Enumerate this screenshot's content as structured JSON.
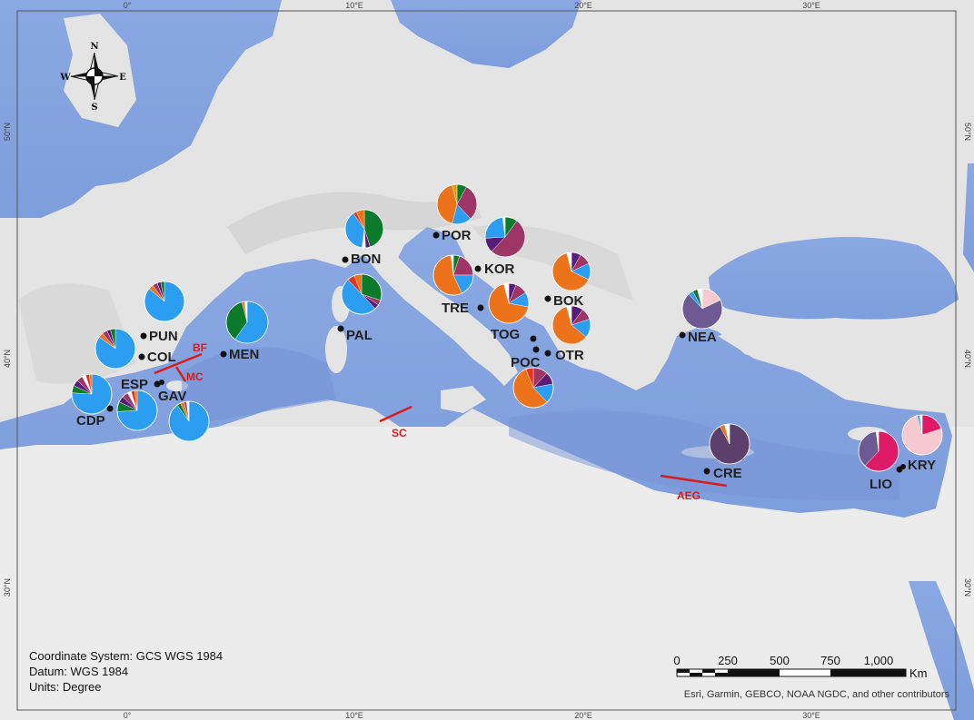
{
  "map": {
    "graticule": {
      "longitude_labels": [
        "0°",
        "10°E",
        "20°E",
        "30°E"
      ],
      "latitude_labels": [
        "50°N",
        "40°N",
        "30°N"
      ]
    },
    "compass": {
      "n": "N",
      "s": "S",
      "e": "E",
      "w": "W"
    },
    "colors": {
      "sea": "#b3c9ee",
      "deep_sea": "#8faee6",
      "land": "#e6e6e6",
      "blue": "#2c9ef2",
      "orange": "#ec7319",
      "green": "#0c7a2b",
      "maroon": "#9d3565",
      "purple": "#5a1c7a",
      "slate_purple": "#6e5a93",
      "dark_purple": "#5c3f6b",
      "magenta": "#de1966",
      "pink": "#f6c8d0",
      "red": "#e8311e",
      "gold": "#d8a21c",
      "white": "#ffffff",
      "barrier": "#d81b1b"
    },
    "sites": [
      {
        "code": "PUN",
        "pie": [
          [
            "blue",
            0.86
          ],
          [
            "orange",
            0.04
          ],
          [
            "maroon",
            0.04
          ],
          [
            "purple",
            0.03
          ],
          [
            "green",
            0.03
          ]
        ]
      },
      {
        "code": "COL",
        "pie": [
          [
            "blue",
            0.85
          ],
          [
            "orange",
            0.04
          ],
          [
            "maroon",
            0.04
          ],
          [
            "purple",
            0.03
          ],
          [
            "green",
            0.04
          ]
        ]
      },
      {
        "code": "ESP",
        "pie": [
          [
            "blue",
            0.9
          ],
          [
            "green",
            0.03
          ],
          [
            "orange",
            0.03
          ],
          [
            "maroon",
            0.02
          ],
          [
            "white",
            0.02
          ]
        ]
      },
      {
        "code": "GAV",
        "pie": [
          [
            "blue",
            0.74
          ],
          [
            "green",
            0.08
          ],
          [
            "purple",
            0.05
          ],
          [
            "maroon",
            0.05
          ],
          [
            "white",
            0.03
          ],
          [
            "red",
            0.03
          ],
          [
            "orange",
            0.02
          ]
        ]
      },
      {
        "code": "CDP",
        "pie": [
          [
            "blue",
            0.76
          ],
          [
            "green",
            0.06
          ],
          [
            "purple",
            0.05
          ],
          [
            "maroon",
            0.05
          ],
          [
            "white",
            0.03
          ],
          [
            "red",
            0.03
          ],
          [
            "orange",
            0.02
          ]
        ]
      },
      {
        "code": "MEN",
        "pie": [
          [
            "blue",
            0.6
          ],
          [
            "green",
            0.36
          ],
          [
            "orange",
            0.02
          ],
          [
            "white",
            0.02
          ]
        ]
      },
      {
        "code": "BON",
        "pie": [
          [
            "green",
            0.45
          ],
          [
            "purple",
            0.04
          ],
          [
            "white",
            0.03
          ],
          [
            "blue",
            0.38
          ],
          [
            "red",
            0.03
          ],
          [
            "orange",
            0.07
          ]
        ]
      },
      {
        "code": "PAL",
        "pie": [
          [
            "green",
            0.3
          ],
          [
            "maroon",
            0.04
          ],
          [
            "purple",
            0.04
          ],
          [
            "blue",
            0.5
          ],
          [
            "red",
            0.06
          ],
          [
            "orange",
            0.06
          ]
        ]
      },
      {
        "code": "POR",
        "pie": [
          [
            "green",
            0.08
          ],
          [
            "maroon",
            0.3
          ],
          [
            "blue",
            0.16
          ],
          [
            "orange",
            0.42
          ],
          [
            "gold",
            0.04
          ]
        ]
      },
      {
        "code": "KOR",
        "pie": [
          [
            "green",
            0.1
          ],
          [
            "maroon",
            0.52
          ],
          [
            "purple",
            0.12
          ],
          [
            "blue",
            0.24
          ],
          [
            "white",
            0.02
          ]
        ]
      },
      {
        "code": "TRE",
        "pie": [
          [
            "green",
            0.05
          ],
          [
            "maroon",
            0.2
          ],
          [
            "blue",
            0.18
          ],
          [
            "orange",
            0.55
          ],
          [
            "white",
            0.02
          ]
        ]
      },
      {
        "code": "TOG",
        "pie": [
          [
            "purple",
            0.06
          ],
          [
            "maroon",
            0.1
          ],
          [
            "blue",
            0.12
          ],
          [
            "orange",
            0.68
          ],
          [
            "white",
            0.04
          ]
        ]
      },
      {
        "code": "BOK",
        "pie": [
          [
            "purple",
            0.08
          ],
          [
            "maroon",
            0.1
          ],
          [
            "blue",
            0.14
          ],
          [
            "orange",
            0.64
          ],
          [
            "white",
            0.04
          ]
        ]
      },
      {
        "code": "OTR",
        "pie": [
          [
            "purple",
            0.1
          ],
          [
            "maroon",
            0.1
          ],
          [
            "blue",
            0.16
          ],
          [
            "orange",
            0.6
          ],
          [
            "white",
            0.04
          ]
        ]
      },
      {
        "code": "POC",
        "pie": [
          [
            "maroon",
            0.12
          ],
          [
            "purple",
            0.1
          ],
          [
            "blue",
            0.16
          ],
          [
            "orange",
            0.56
          ],
          [
            "red",
            0.06
          ]
        ]
      },
      {
        "code": "NEA",
        "pie": [
          [
            "pink",
            0.18
          ],
          [
            "slate_purple",
            0.7
          ],
          [
            "blue",
            0.04
          ],
          [
            "green",
            0.04
          ],
          [
            "white",
            0.04
          ]
        ]
      },
      {
        "code": "CRE",
        "pie": [
          [
            "dark_purple",
            0.92
          ],
          [
            "orange",
            0.04
          ],
          [
            "white",
            0.04
          ]
        ]
      },
      {
        "code": "LIO",
        "pie": [
          [
            "magenta",
            0.62
          ],
          [
            "slate_purple",
            0.36
          ],
          [
            "white",
            0.02
          ]
        ]
      },
      {
        "code": "KRY",
        "pie": [
          [
            "magenta",
            0.2
          ],
          [
            "pink",
            0.76
          ],
          [
            "blue",
            0.02
          ],
          [
            "white",
            0.02
          ]
        ]
      }
    ],
    "barriers": [
      "BF",
      "MC",
      "SC",
      "AEG"
    ],
    "coordinate_info": {
      "line1": "Coordinate System: GCS WGS 1984",
      "line2": "Datum: WGS 1984",
      "line3": "Units: Degree"
    },
    "scale_bar": {
      "labels": [
        "0",
        "250",
        "500",
        "750",
        "1,000"
      ],
      "unit": "Km"
    },
    "credits": "Esri, Garmin, GEBCO, NOAA NGDC, and other contributors"
  }
}
